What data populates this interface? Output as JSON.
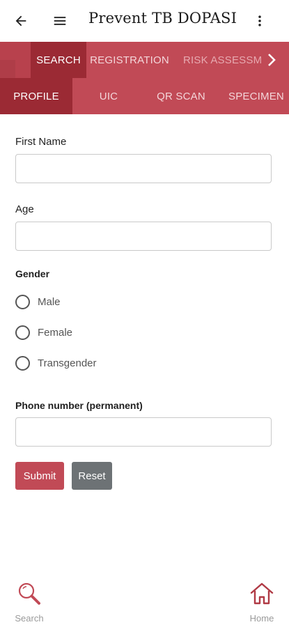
{
  "app": {
    "title": "Prevent TB DOPASI"
  },
  "colors": {
    "primary": "#c14a56",
    "primary_dark": "#9b2a34",
    "reset_button": "#6d7275"
  },
  "icons": {
    "back": "arrow-left-icon",
    "menu": "hamburger-menu-icon",
    "more": "more-vert-icon",
    "tabs_next": "chevron-right-icon",
    "search": "magnifier-icon",
    "home": "home-icon"
  },
  "tabs_top": [
    {
      "label": "SEARCH",
      "active": true
    },
    {
      "label": "REGISTRATION",
      "active": false
    },
    {
      "label": "RISK ASSESSMENT",
      "active": false
    }
  ],
  "tabs_bottom": [
    {
      "label": "PROFILE",
      "active": true
    },
    {
      "label": "UIC",
      "active": false
    },
    {
      "label": "QR SCAN",
      "active": false
    },
    {
      "label": "SPECIMEN",
      "active": false
    }
  ],
  "form": {
    "first_name": {
      "label": "First Name",
      "value": ""
    },
    "age": {
      "label": "Age",
      "value": ""
    },
    "gender": {
      "label": "Gender",
      "options": [
        "Male",
        "Female",
        "Transgender"
      ],
      "selected": null
    },
    "phone": {
      "label": "Phone number (permanent)",
      "value": ""
    },
    "submit_label": "Submit",
    "reset_label": "Reset"
  },
  "bottom_nav": {
    "search_label": "Search",
    "home_label": "Home"
  }
}
